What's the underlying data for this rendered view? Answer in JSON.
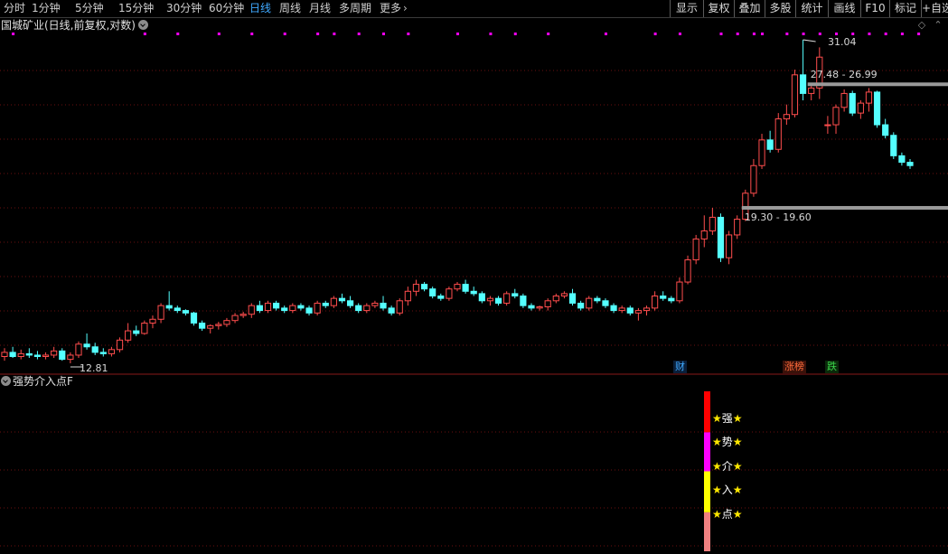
{
  "toolbar": {
    "periods": [
      "分时",
      "1分钟",
      "5分钟",
      "15分钟",
      "30分钟",
      "60分钟",
      "日线",
      "周线",
      "月线",
      "多周期",
      "更多"
    ],
    "active_period": "日线",
    "more_arrow": "›",
    "buttons": [
      "显示",
      "复权",
      "叠加",
      "多股",
      "统计",
      "画线",
      "F10",
      "标记",
      "+自选"
    ]
  },
  "main_chart": {
    "title": "国城矿业(日线,前复权,对数)",
    "high_label": "31.04",
    "low_label": "12.81",
    "zone_upper_label": "27.48 - 26.99",
    "zone_lower_label": "19.30 - 19.60",
    "tags": [
      {
        "text": "财",
        "color": "#3fa9ff",
        "bg": "#0a1f3a"
      },
      {
        "text": "涨榜",
        "color": "#ff6a3a",
        "bg": "#3a120a"
      },
      {
        "text": "跌",
        "color": "#3ad64a",
        "bg": "#0a2a0a"
      }
    ],
    "colors": {
      "up": "#ff4d4d",
      "down": "#54ffff",
      "dots": "#ff00ff",
      "zone": "#9a9a9a",
      "grid": "#6a1010"
    }
  },
  "chart_data": {
    "type": "candlestick",
    "title": "国城矿业(日线,前复权,对数)",
    "scale": "log",
    "y_labels": {
      "high": 31.04,
      "low": 12.81
    },
    "zones": [
      {
        "from": 27.48,
        "to": 26.99
      },
      {
        "from": 19.3,
        "to": 19.6
      }
    ],
    "candles": [
      {
        "o": 13.05,
        "h": 13.35,
        "l": 12.9,
        "c": 13.2
      },
      {
        "o": 13.2,
        "h": 13.4,
        "l": 13.0,
        "c": 13.05
      },
      {
        "o": 13.05,
        "h": 13.3,
        "l": 12.95,
        "c": 13.15
      },
      {
        "o": 13.15,
        "h": 13.35,
        "l": 13.0,
        "c": 13.1
      },
      {
        "o": 13.1,
        "h": 13.25,
        "l": 12.95,
        "c": 13.05
      },
      {
        "o": 13.05,
        "h": 13.2,
        "l": 12.95,
        "c": 13.1
      },
      {
        "o": 13.1,
        "h": 13.4,
        "l": 13.0,
        "c": 13.25
      },
      {
        "o": 13.25,
        "h": 13.35,
        "l": 12.9,
        "c": 12.95
      },
      {
        "o": 12.95,
        "h": 13.2,
        "l": 12.81,
        "c": 13.1
      },
      {
        "o": 13.1,
        "h": 13.6,
        "l": 13.0,
        "c": 13.5
      },
      {
        "o": 13.5,
        "h": 13.9,
        "l": 13.3,
        "c": 13.4
      },
      {
        "o": 13.4,
        "h": 13.55,
        "l": 13.1,
        "c": 13.2
      },
      {
        "o": 13.2,
        "h": 13.35,
        "l": 13.05,
        "c": 13.15
      },
      {
        "o": 13.15,
        "h": 13.4,
        "l": 13.05,
        "c": 13.3
      },
      {
        "o": 13.3,
        "h": 13.75,
        "l": 13.2,
        "c": 13.65
      },
      {
        "o": 13.65,
        "h": 14.3,
        "l": 13.55,
        "c": 14.0
      },
      {
        "o": 14.0,
        "h": 14.2,
        "l": 13.8,
        "c": 13.9
      },
      {
        "o": 13.9,
        "h": 14.4,
        "l": 13.85,
        "c": 14.3
      },
      {
        "o": 14.3,
        "h": 14.6,
        "l": 14.1,
        "c": 14.45
      },
      {
        "o": 14.45,
        "h": 15.1,
        "l": 14.3,
        "c": 15.0
      },
      {
        "o": 15.0,
        "h": 15.6,
        "l": 14.8,
        "c": 14.9
      },
      {
        "o": 14.9,
        "h": 15.0,
        "l": 14.7,
        "c": 14.8
      },
      {
        "o": 14.8,
        "h": 14.85,
        "l": 14.6,
        "c": 14.7
      },
      {
        "o": 14.7,
        "h": 14.75,
        "l": 14.2,
        "c": 14.3
      },
      {
        "o": 14.3,
        "h": 14.4,
        "l": 14.0,
        "c": 14.1
      },
      {
        "o": 14.1,
        "h": 14.25,
        "l": 13.9,
        "c": 14.2
      },
      {
        "o": 14.2,
        "h": 14.35,
        "l": 14.05,
        "c": 14.25
      },
      {
        "o": 14.25,
        "h": 14.5,
        "l": 14.15,
        "c": 14.4
      },
      {
        "o": 14.4,
        "h": 14.7,
        "l": 14.3,
        "c": 14.6
      },
      {
        "o": 14.6,
        "h": 14.75,
        "l": 14.5,
        "c": 14.65
      },
      {
        "o": 14.65,
        "h": 15.1,
        "l": 14.5,
        "c": 15.0
      },
      {
        "o": 15.0,
        "h": 15.2,
        "l": 14.7,
        "c": 14.8
      },
      {
        "o": 14.8,
        "h": 15.2,
        "l": 14.7,
        "c": 15.1
      },
      {
        "o": 15.1,
        "h": 15.2,
        "l": 14.8,
        "c": 14.9
      },
      {
        "o": 14.9,
        "h": 15.0,
        "l": 14.7,
        "c": 14.8
      },
      {
        "o": 14.8,
        "h": 15.1,
        "l": 14.7,
        "c": 15.0
      },
      {
        "o": 15.0,
        "h": 15.1,
        "l": 14.8,
        "c": 14.9
      },
      {
        "o": 14.9,
        "h": 15.0,
        "l": 14.6,
        "c": 14.7
      },
      {
        "o": 14.7,
        "h": 15.2,
        "l": 14.6,
        "c": 15.1
      },
      {
        "o": 15.1,
        "h": 15.2,
        "l": 14.9,
        "c": 15.0
      },
      {
        "o": 15.0,
        "h": 15.4,
        "l": 14.9,
        "c": 15.3
      },
      {
        "o": 15.3,
        "h": 15.5,
        "l": 15.1,
        "c": 15.2
      },
      {
        "o": 15.2,
        "h": 15.4,
        "l": 14.9,
        "c": 15.0
      },
      {
        "o": 15.0,
        "h": 15.1,
        "l": 14.7,
        "c": 14.8
      },
      {
        "o": 14.8,
        "h": 15.1,
        "l": 14.7,
        "c": 15.0
      },
      {
        "o": 15.0,
        "h": 15.2,
        "l": 14.9,
        "c": 15.1
      },
      {
        "o": 15.1,
        "h": 15.4,
        "l": 14.8,
        "c": 14.9
      },
      {
        "o": 14.9,
        "h": 15.0,
        "l": 14.6,
        "c": 14.7
      },
      {
        "o": 14.7,
        "h": 15.3,
        "l": 14.6,
        "c": 15.2
      },
      {
        "o": 15.2,
        "h": 15.8,
        "l": 15.0,
        "c": 15.6
      },
      {
        "o": 15.6,
        "h": 16.1,
        "l": 15.4,
        "c": 15.9
      },
      {
        "o": 15.9,
        "h": 16.0,
        "l": 15.6,
        "c": 15.7
      },
      {
        "o": 15.7,
        "h": 15.8,
        "l": 15.3,
        "c": 15.4
      },
      {
        "o": 15.4,
        "h": 15.5,
        "l": 15.2,
        "c": 15.3
      },
      {
        "o": 15.3,
        "h": 15.8,
        "l": 15.2,
        "c": 15.7
      },
      {
        "o": 15.7,
        "h": 16.0,
        "l": 15.6,
        "c": 15.9
      },
      {
        "o": 15.9,
        "h": 16.1,
        "l": 15.5,
        "c": 15.6
      },
      {
        "o": 15.6,
        "h": 15.8,
        "l": 15.4,
        "c": 15.5
      },
      {
        "o": 15.5,
        "h": 15.6,
        "l": 15.1,
        "c": 15.2
      },
      {
        "o": 15.2,
        "h": 15.4,
        "l": 15.0,
        "c": 15.3
      },
      {
        "o": 15.3,
        "h": 15.4,
        "l": 15.0,
        "c": 15.1
      },
      {
        "o": 15.1,
        "h": 15.6,
        "l": 15.0,
        "c": 15.5
      },
      {
        "o": 15.5,
        "h": 15.7,
        "l": 15.3,
        "c": 15.4
      },
      {
        "o": 15.4,
        "h": 15.5,
        "l": 14.9,
        "c": 15.0
      },
      {
        "o": 15.0,
        "h": 15.1,
        "l": 14.8,
        "c": 14.9
      },
      {
        "o": 14.9,
        "h": 15.0,
        "l": 14.8,
        "c": 14.95
      },
      {
        "o": 14.95,
        "h": 15.3,
        "l": 14.8,
        "c": 15.2
      },
      {
        "o": 15.2,
        "h": 15.5,
        "l": 15.1,
        "c": 15.4
      },
      {
        "o": 15.4,
        "h": 15.6,
        "l": 15.3,
        "c": 15.5
      },
      {
        "o": 15.5,
        "h": 15.7,
        "l": 15.0,
        "c": 15.1
      },
      {
        "o": 15.1,
        "h": 15.2,
        "l": 14.8,
        "c": 14.9
      },
      {
        "o": 14.9,
        "h": 15.4,
        "l": 14.8,
        "c": 15.3
      },
      {
        "o": 15.3,
        "h": 15.4,
        "l": 15.1,
        "c": 15.2
      },
      {
        "o": 15.2,
        "h": 15.3,
        "l": 14.9,
        "c": 15.0
      },
      {
        "o": 15.0,
        "h": 15.1,
        "l": 14.7,
        "c": 14.8
      },
      {
        "o": 14.8,
        "h": 15.0,
        "l": 14.7,
        "c": 14.9
      },
      {
        "o": 14.9,
        "h": 15.0,
        "l": 14.6,
        "c": 14.7
      },
      {
        "o": 14.7,
        "h": 14.9,
        "l": 14.4,
        "c": 14.8
      },
      {
        "o": 14.8,
        "h": 15.0,
        "l": 14.6,
        "c": 14.9
      },
      {
        "o": 14.9,
        "h": 15.6,
        "l": 14.8,
        "c": 15.4
      },
      {
        "o": 15.4,
        "h": 15.6,
        "l": 15.2,
        "c": 15.3
      },
      {
        "o": 15.3,
        "h": 15.4,
        "l": 15.1,
        "c": 15.2
      },
      {
        "o": 15.2,
        "h": 16.2,
        "l": 15.1,
        "c": 16.0
      },
      {
        "o": 16.0,
        "h": 17.2,
        "l": 15.9,
        "c": 17.0
      },
      {
        "o": 17.0,
        "h": 18.2,
        "l": 16.8,
        "c": 18.0
      },
      {
        "o": 18.0,
        "h": 19.2,
        "l": 17.6,
        "c": 18.4
      },
      {
        "o": 18.4,
        "h": 19.6,
        "l": 18.2,
        "c": 19.1
      },
      {
        "o": 19.1,
        "h": 19.3,
        "l": 16.9,
        "c": 17.1
      },
      {
        "o": 17.1,
        "h": 18.4,
        "l": 16.8,
        "c": 18.2
      },
      {
        "o": 18.2,
        "h": 19.2,
        "l": 18.0,
        "c": 19.0
      },
      {
        "o": 19.0,
        "h": 20.6,
        "l": 18.9,
        "c": 20.4
      },
      {
        "o": 20.4,
        "h": 22.4,
        "l": 20.2,
        "c": 22.0
      },
      {
        "o": 22.0,
        "h": 24.0,
        "l": 21.8,
        "c": 23.6
      },
      {
        "o": 23.6,
        "h": 24.2,
        "l": 22.8,
        "c": 23.0
      },
      {
        "o": 23.0,
        "h": 25.4,
        "l": 22.8,
        "c": 25.0
      },
      {
        "o": 25.0,
        "h": 26.0,
        "l": 24.6,
        "c": 25.3
      },
      {
        "o": 25.3,
        "h": 28.6,
        "l": 25.1,
        "c": 28.2
      },
      {
        "o": 28.2,
        "h": 31.04,
        "l": 26.3,
        "c": 26.8
      },
      {
        "o": 26.8,
        "h": 27.4,
        "l": 26.3,
        "c": 27.2
      },
      {
        "o": 27.2,
        "h": 30.4,
        "l": 26.4,
        "c": 29.6
      },
      {
        "o": 24.6,
        "h": 25.2,
        "l": 24.0,
        "c": 24.6
      },
      {
        "o": 24.6,
        "h": 26.0,
        "l": 24.0,
        "c": 25.8
      },
      {
        "o": 25.8,
        "h": 27.1,
        "l": 25.5,
        "c": 26.8
      },
      {
        "o": 26.8,
        "h": 27.0,
        "l": 25.2,
        "c": 25.4
      },
      {
        "o": 25.4,
        "h": 26.3,
        "l": 25.0,
        "c": 26.1
      },
      {
        "o": 26.1,
        "h": 27.2,
        "l": 25.5,
        "c": 26.9
      },
      {
        "o": 26.9,
        "h": 27.0,
        "l": 24.4,
        "c": 24.6
      },
      {
        "o": 24.6,
        "h": 25.0,
        "l": 23.7,
        "c": 23.9
      },
      {
        "o": 23.9,
        "h": 24.1,
        "l": 22.4,
        "c": 22.6
      },
      {
        "o": 22.6,
        "h": 22.8,
        "l": 22.0,
        "c": 22.2
      },
      {
        "o": 22.2,
        "h": 22.4,
        "l": 21.8,
        "c": 22.0
      }
    ]
  },
  "indicator": {
    "title": "强势介入点F",
    "labels": [
      "强",
      "势",
      "介",
      "入",
      "点"
    ],
    "star": "★",
    "segments": [
      {
        "color": "#ff0000",
        "weight": 1.0
      },
      {
        "color": "#ff00ff",
        "weight": 0.95
      },
      {
        "color": "#ffff00",
        "weight": 1.0
      },
      {
        "color": "#f08080",
        "weight": 0.95
      }
    ]
  }
}
